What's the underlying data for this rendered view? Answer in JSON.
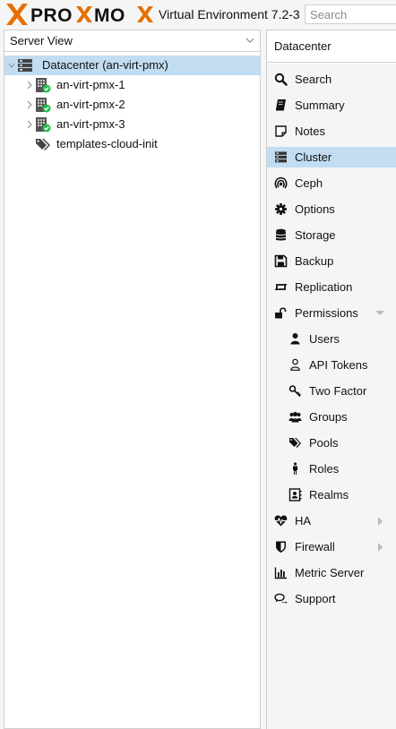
{
  "header": {
    "brand": "PROXMOX",
    "version": "Virtual Environment 7.2-3",
    "search_placeholder": "Search"
  },
  "left": {
    "view_select": "Server View",
    "tree": [
      {
        "label": "Datacenter (an-virt-pmx)",
        "icon": "datacenter-icon",
        "selected": true
      },
      {
        "label": "an-virt-pmx-1",
        "icon": "node-online-icon"
      },
      {
        "label": "an-virt-pmx-2",
        "icon": "node-online-icon"
      },
      {
        "label": "an-virt-pmx-3",
        "icon": "node-online-icon"
      },
      {
        "label": "templates-cloud-init",
        "icon": "tags-icon"
      }
    ]
  },
  "right": {
    "title": "Datacenter",
    "menu": [
      {
        "label": "Search",
        "icon": "search-icon"
      },
      {
        "label": "Summary",
        "icon": "book-icon"
      },
      {
        "label": "Notes",
        "icon": "note-icon"
      },
      {
        "label": "Cluster",
        "icon": "server-icon",
        "selected": true
      },
      {
        "label": "Ceph",
        "icon": "ceph-icon"
      },
      {
        "label": "Options",
        "icon": "gear-icon"
      },
      {
        "label": "Storage",
        "icon": "database-icon"
      },
      {
        "label": "Backup",
        "icon": "floppy-icon"
      },
      {
        "label": "Replication",
        "icon": "retweet-icon"
      },
      {
        "label": "Permissions",
        "icon": "unlock-icon",
        "expander": "down"
      },
      {
        "label": "Users",
        "icon": "user-icon",
        "sub": true
      },
      {
        "label": "API Tokens",
        "icon": "user-outline-icon",
        "sub": true
      },
      {
        "label": "Two Factor",
        "icon": "key-icon",
        "sub": true
      },
      {
        "label": "Groups",
        "icon": "users-icon",
        "sub": true
      },
      {
        "label": "Pools",
        "icon": "tags-icon",
        "sub": true
      },
      {
        "label": "Roles",
        "icon": "male-icon",
        "sub": true
      },
      {
        "label": "Realms",
        "icon": "address-book-icon",
        "sub": true
      },
      {
        "label": "HA",
        "icon": "heartbeat-icon",
        "expander": "right"
      },
      {
        "label": "Firewall",
        "icon": "shield-icon",
        "expander": "right"
      },
      {
        "label": "Metric Server",
        "icon": "bar-chart-icon"
      },
      {
        "label": "Support",
        "icon": "comments-icon"
      }
    ]
  }
}
